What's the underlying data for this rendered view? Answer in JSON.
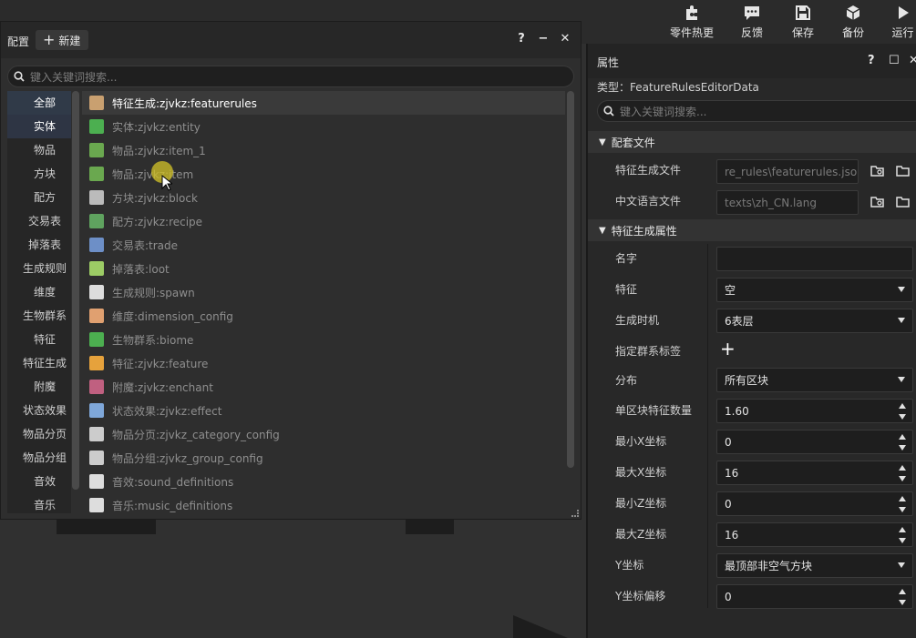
{
  "toolbar": {
    "items": [
      {
        "label": "零件热更",
        "icon": "puzzle-icon"
      },
      {
        "label": "反馈",
        "icon": "chat-icon"
      },
      {
        "label": "保存",
        "icon": "save-icon"
      },
      {
        "label": "备份",
        "icon": "cube-icon"
      },
      {
        "label": "运行",
        "icon": "play-icon"
      }
    ]
  },
  "config_panel": {
    "title": "配置",
    "new_label": "新建",
    "help": "?",
    "minimize": "−",
    "close": "✕",
    "search_placeholder": "键入关键词搜索...",
    "categories": [
      "全部",
      "实体",
      "物品",
      "方块",
      "配方",
      "交易表",
      "掉落表",
      "生成规则",
      "维度",
      "生物群系",
      "特征",
      "特征生成",
      "附魔",
      "状态效果",
      "物品分页",
      "物品分组",
      "音效",
      "音乐"
    ],
    "items": [
      {
        "label": "特征生成:zjvkz:featurerules",
        "color": "#c9a070"
      },
      {
        "label": "实体:zjvkz:entity",
        "color": "#4caf50"
      },
      {
        "label": "物品:zjvkz:item_1",
        "color": "#6aa84f"
      },
      {
        "label": "物品:zjvkz:item",
        "color": "#6aa84f"
      },
      {
        "label": "方块:zjvkz:block",
        "color": "#bbbbbb"
      },
      {
        "label": "配方:zjvkz:recipe",
        "color": "#5fa35f"
      },
      {
        "label": "交易表:trade",
        "color": "#6d8fc7"
      },
      {
        "label": "掉落表:loot",
        "color": "#9ccc65"
      },
      {
        "label": "生成规则:spawn",
        "color": "#dddddd"
      },
      {
        "label": "维度:dimension_config",
        "color": "#e0a070"
      },
      {
        "label": "生物群系:biome",
        "color": "#4caf50"
      },
      {
        "label": "特征:zjvkz:feature",
        "color": "#e6a23c"
      },
      {
        "label": "附魔:zjvkz:enchant",
        "color": "#c06080"
      },
      {
        "label": "状态效果:zjvkz:effect",
        "color": "#7fa7d9"
      },
      {
        "label": "物品分页:zjvkz_category_config",
        "color": "#cccccc"
      },
      {
        "label": "物品分组:zjvkz_group_config",
        "color": "#cccccc"
      },
      {
        "label": "音效:sound_definitions",
        "color": "#dddddd"
      },
      {
        "label": "音乐:music_definitions",
        "color": "#dddddd"
      }
    ]
  },
  "properties": {
    "title": "属性",
    "type_line": "类型：FeatureRulesEditorData",
    "search_placeholder": "键入关键词搜索...",
    "sections": {
      "files": "配套文件",
      "attributes": "特征生成属性"
    },
    "files": [
      {
        "label": "特征生成文件",
        "value": "re_rules\\featurerules.json"
      },
      {
        "label": "中文语言文件",
        "value": "texts\\zh_CN.lang"
      }
    ],
    "fields": {
      "name": {
        "label": "名字",
        "value": ""
      },
      "feature": {
        "label": "特征",
        "value": "空"
      },
      "timing": {
        "label": "生成时机",
        "value": "6表层"
      },
      "biome_tag": {
        "label": "指定群系标签",
        "value": "+"
      },
      "distribution": {
        "label": "分布",
        "value": "所有区块"
      },
      "count": {
        "label": "单区块特征数量",
        "value": "1.60"
      },
      "min_x": {
        "label": "最小X坐标",
        "value": "0"
      },
      "max_x": {
        "label": "最大X坐标",
        "value": "16"
      },
      "min_z": {
        "label": "最小Z坐标",
        "value": "0"
      },
      "max_z": {
        "label": "最大Z坐标",
        "value": "16"
      },
      "y": {
        "label": "Y坐标",
        "value": "最顶部非空气方块"
      },
      "y_offset": {
        "label": "Y坐标偏移",
        "value": "0"
      }
    }
  }
}
